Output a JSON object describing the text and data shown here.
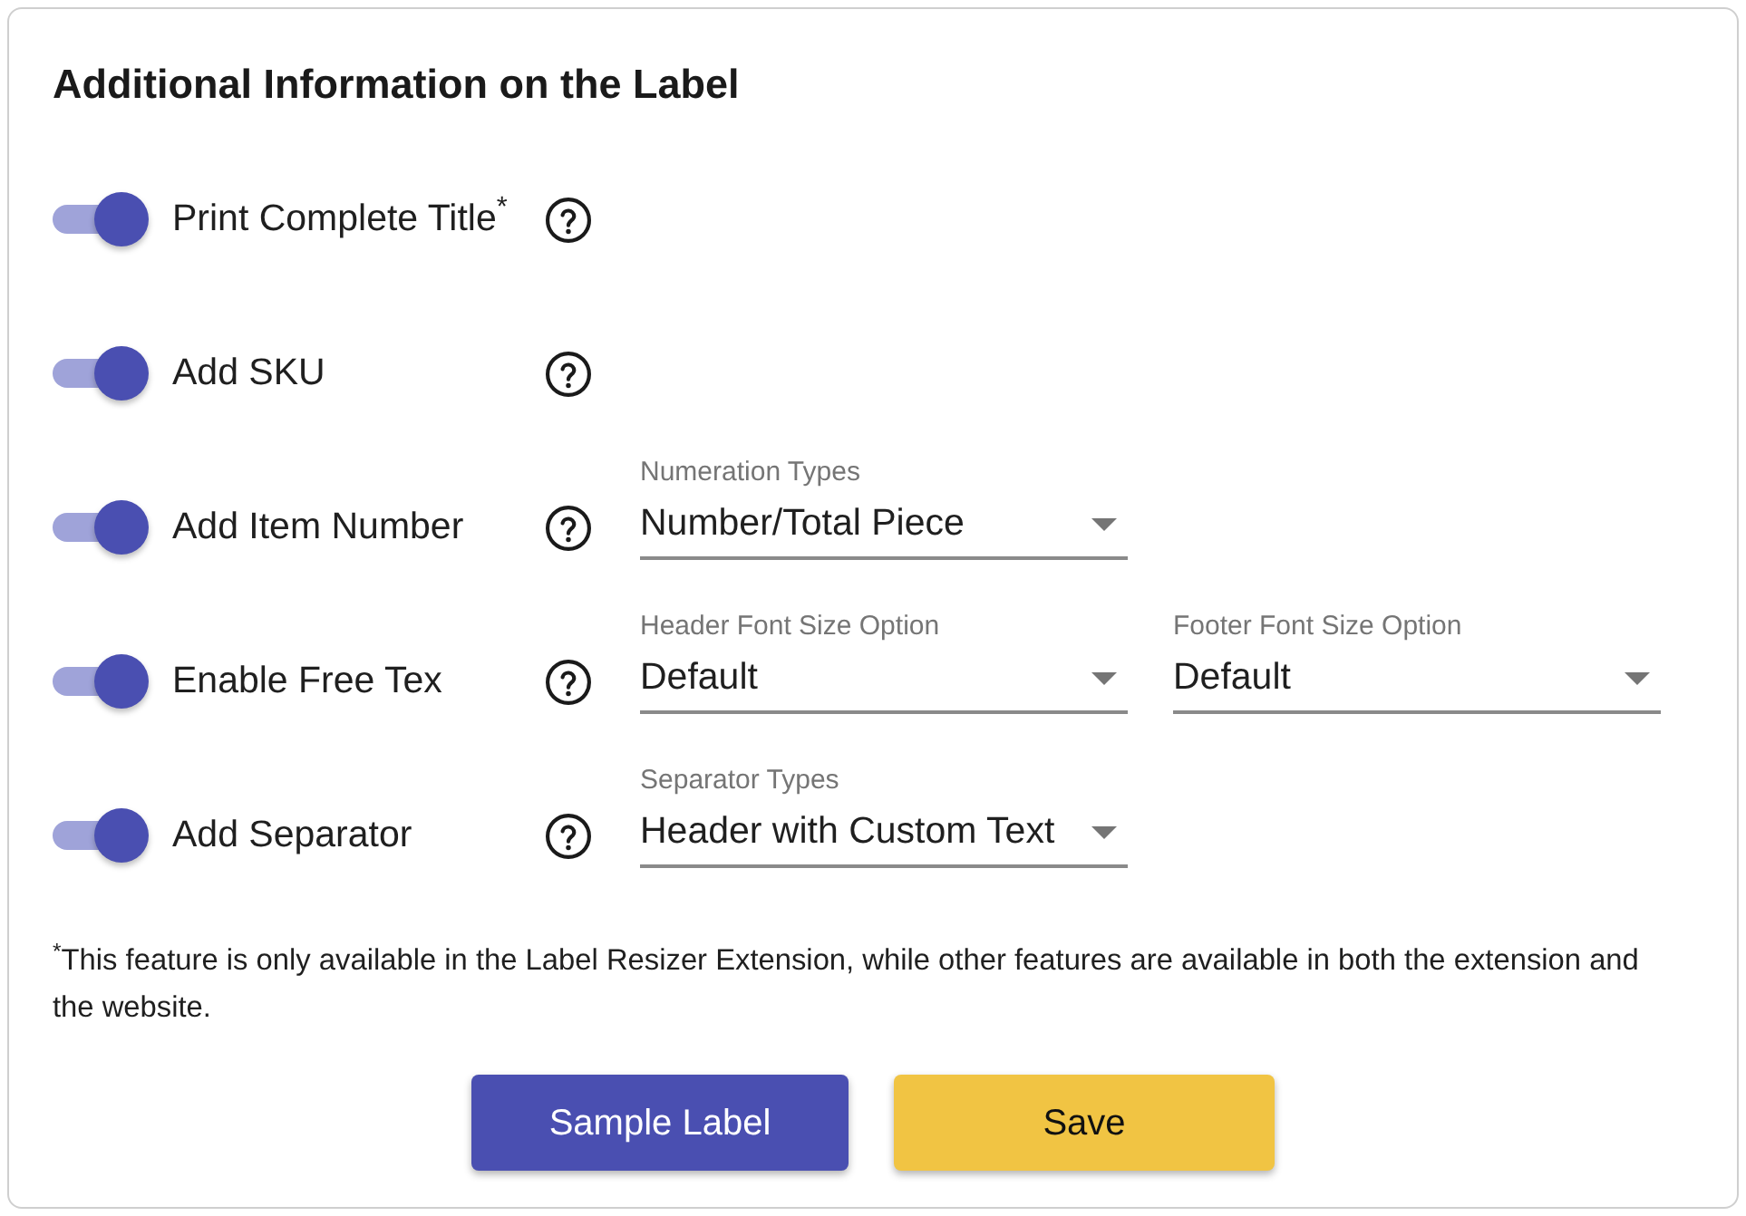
{
  "card": {
    "title": "Additional Information on the Label"
  },
  "options": [
    {
      "label": "Print Complete Title$^{*}$",
      "on": true
    },
    {
      "label": "Add SKU",
      "on": true
    },
    {
      "label": "Add Item Number",
      "on": true,
      "selects": [
        {
          "label": "Numeration Types",
          "value": "Number/Total Piece"
        }
      ]
    },
    {
      "label": "Enable Free Tex",
      "on": true,
      "selects": [
        {
          "label": "Header Font Size Option",
          "value": "Default"
        },
        {
          "label": "Footer Font Size Option",
          "value": "Default"
        }
      ]
    },
    {
      "label": "Add Separator",
      "on": true,
      "selects": [
        {
          "label": "Separator Types",
          "value": "Header with Custom Text"
        }
      ]
    }
  ],
  "footnote": "$^{*}$This feature is only available in the Label Resizer Extension, while other features are available in both the extension and the website.",
  "buttons": [
    {
      "label": "Sample Label",
      "kind": "primary"
    },
    {
      "label": "Save",
      "kind": "secondary"
    }
  ]
}
